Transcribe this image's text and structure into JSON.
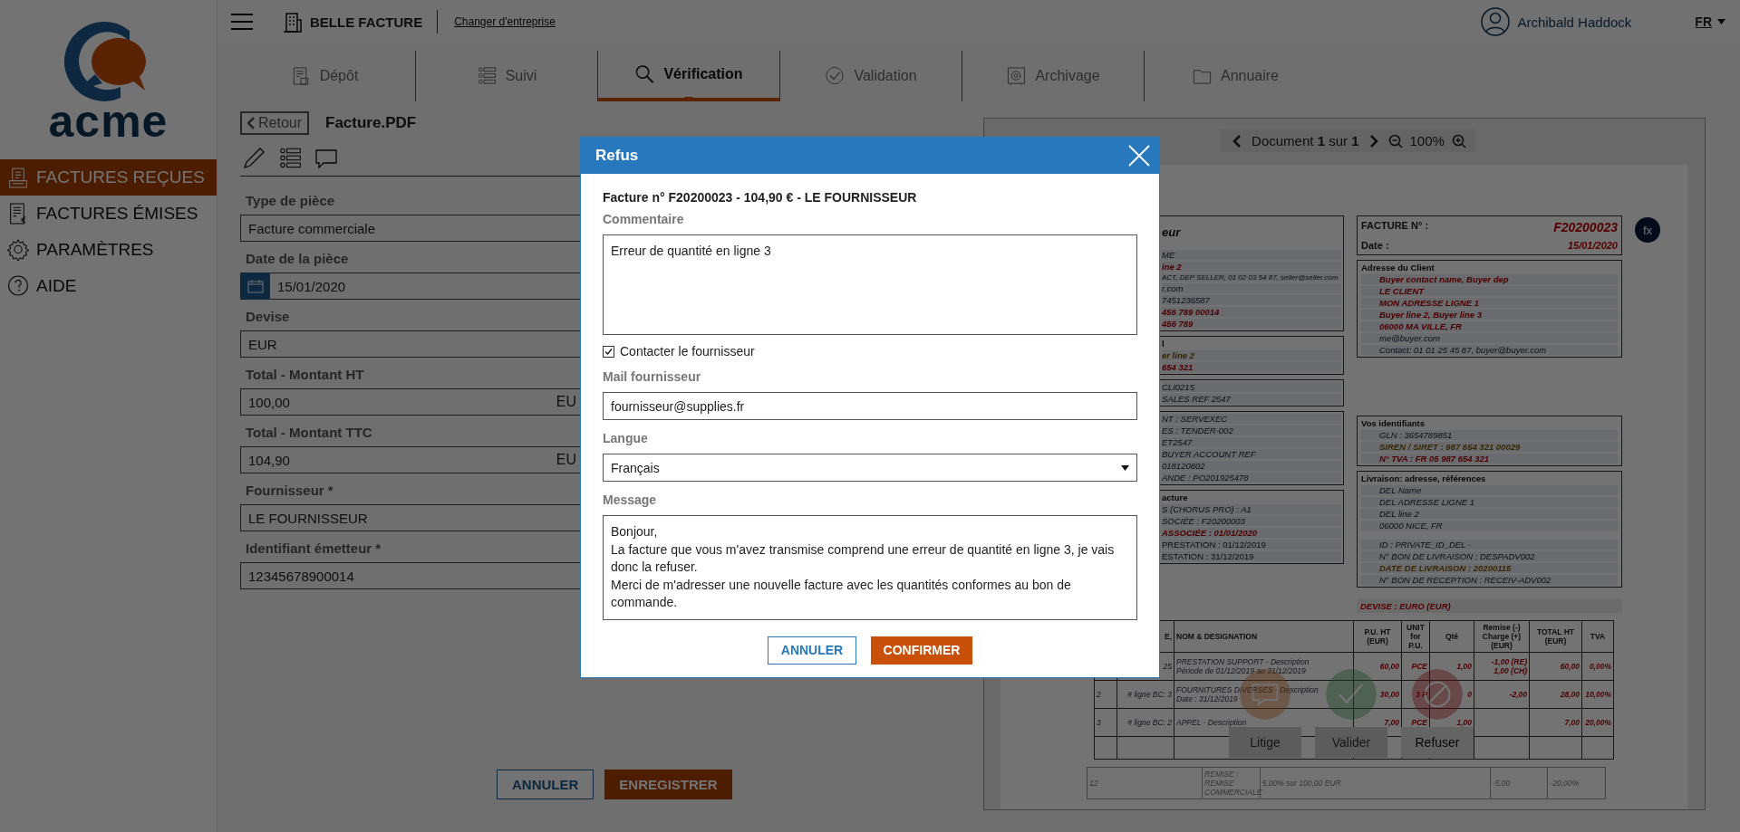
{
  "sidebar": {
    "logo_text": "acme",
    "items": [
      {
        "label": "FACTURES REÇUES",
        "selected": true
      },
      {
        "label": "FACTURES ÉMISES",
        "selected": false
      },
      {
        "label": "PARAMÈTRES",
        "selected": false
      },
      {
        "label": "AIDE",
        "selected": false
      }
    ]
  },
  "topbar": {
    "company": "BELLE FACTURE",
    "switch_link": "Changer d'entreprise",
    "user": "Archibald Haddock",
    "language": "FR"
  },
  "tabs": [
    {
      "label": "Dépôt",
      "selected": false
    },
    {
      "label": "Suivi",
      "selected": false
    },
    {
      "label": "Vérification",
      "selected": true
    },
    {
      "label": "Validation",
      "selected": false
    },
    {
      "label": "Archivage",
      "selected": false
    },
    {
      "label": "Annuaire",
      "selected": false
    }
  ],
  "form": {
    "back": "Retour",
    "filename": "Facture.PDF",
    "fields": [
      {
        "label": "Type de pièce",
        "value": "Facture commerciale",
        "kind": "text"
      },
      {
        "label": "Date de la pièce",
        "value": "15/01/2020",
        "kind": "date"
      },
      {
        "label": "Devise",
        "value": "EUR",
        "kind": "text"
      },
      {
        "label": "Total - Montant HT",
        "value": "100,00",
        "kind": "amount",
        "suffix": "EU"
      },
      {
        "label": "Total - Montant TTC",
        "value": "104,90",
        "kind": "amount",
        "suffix": "EU"
      },
      {
        "label": "Fournisseur *",
        "value": "LE FOURNISSEUR",
        "kind": "text"
      },
      {
        "label": "Identifiant émetteur *",
        "value": "12345678900014",
        "kind": "text"
      }
    ],
    "cancel": "ANNULER",
    "save": "ENREGISTRER"
  },
  "document": {
    "pager": "Document **1** sur **1**",
    "zoom": "100%",
    "logo_text": "fx",
    "left_blocks": [
      {
        "lines": [
          {
            "text": "eur",
            "kind": "title"
          },
          {
            "text": "ME",
            "kind": "plain"
          },
          {
            "text": "ine 2",
            "kind": "red"
          },
          {
            "text": "ACT, DEP SELLER, 01 02 03 54 87, seller@seller.com",
            "kind": "small"
          },
          {
            "text": "r.com",
            "kind": "plain"
          },
          {
            "text": "7451236587",
            "kind": "plain"
          },
          {
            "text": "456 789 00014",
            "kind": "red"
          },
          {
            "text": "456 789",
            "kind": "red"
          }
        ]
      },
      {
        "lines": [
          {
            "text": "l",
            "kind": "heading"
          },
          {
            "text": "er line 2",
            "kind": "gold"
          },
          {
            "text": "654 321",
            "kind": "red"
          }
        ]
      },
      {
        "lines": [
          {
            "text": "CLI0215",
            "kind": "plain"
          },
          {
            "text": "SALES REF 2547",
            "kind": "plain"
          }
        ]
      },
      {
        "lines": [
          {
            "text": "NT : SERVEXEC",
            "kind": "plain"
          },
          {
            "text": "ES : TENDER-002",
            "kind": "plain"
          },
          {
            "text": "ET2547",
            "kind": "plain"
          },
          {
            "text": "BUYER ACCOUNT REF",
            "kind": "plain"
          },
          {
            "text": "018120802",
            "kind": "plain"
          },
          {
            "text": "ANDE : PO201925478",
            "kind": "plain"
          }
        ]
      },
      {
        "lines": [
          {
            "text": "acture",
            "kind": "heading"
          },
          {
            "text": "S (CHORUS PRO) : A1",
            "kind": "plain"
          },
          {
            "text": "SOCIÉE : F20200003",
            "kind": "plain"
          },
          {
            "text": "ASSOCIÉE : 01/01/2020",
            "kind": "red"
          },
          {
            "text": "PRESTATION : 01/12/2019",
            "kind": "upright"
          },
          {
            "text": "ESTATION : 31/12/2019",
            "kind": "upright"
          }
        ]
      }
    ],
    "invoice": {
      "number_label": "FACTURE N° :",
      "number": "F20200023",
      "date_label": "Date :",
      "date": "15/01/2020"
    },
    "right_blocks": [
      {
        "lines": [
          {
            "text": "Adresse du Client",
            "kind": "heading"
          },
          {
            "text": "Buyer contact name, Buyer dep",
            "kind": "red"
          },
          {
            "text": "LE CLIENT",
            "kind": "red"
          },
          {
            "text": "MON ADRESSE LIGNE 1",
            "kind": "red"
          },
          {
            "text": "Buyer line 2, Buyer line 3",
            "kind": "red"
          },
          {
            "text": "06000 MA VILLE, FR",
            "kind": "red"
          },
          {
            "text": "me@buyer.com",
            "kind": "plain"
          },
          {
            "text": "Contact: 01 01 25 45 87, buyer@buyer.com",
            "kind": "plain"
          }
        ]
      },
      {
        "lines": [
          {
            "text": "Vos identifiants",
            "kind": "heading"
          },
          {
            "text": "GLN : 3654789851",
            "kind": "plain"
          },
          {
            "text": "SIREN / SIRET : 987 654 321 00029",
            "kind": "gold"
          },
          {
            "text": "N° TVA : FR 05 987 654 321",
            "kind": "red"
          }
        ]
      },
      {
        "lines": [
          {
            "text": "Livraison: adresse, références",
            "kind": "heading"
          },
          {
            "text": "DEL Name",
            "kind": "plain"
          },
          {
            "text": "DEL ADRESSE LIGNE 1",
            "kind": "plain"
          },
          {
            "text": "DEL line 2",
            "kind": "plain"
          },
          {
            "text": "06000 NICE, FR",
            "kind": "plain"
          },
          {
            "text": "ID : PRIVATE_ID_DEL -",
            "kind": "spaced"
          },
          {
            "text": "N° BON DE LIVRAISON : DESPADV002",
            "kind": "plain"
          },
          {
            "text": "DATE DE LIVRAISON : 20200115",
            "kind": "gold"
          },
          {
            "text": "N° BON DE RECEPTION : RECEIV-ADV002",
            "kind": "plain"
          }
        ]
      }
    ],
    "currency": "DEVISE : EURO (EUR)",
    "table": {
      "columns": [
        null,
        "E,",
        "NOM & DESIGNATION",
        "P.U. HT (EUR)",
        "UNIT for P.U.",
        "Qté",
        "Remise (-) Charge (+) (EUR)",
        "TOTAL HT (EUR)",
        "TVA"
      ],
      "rows": [
        [
          null,
          "25",
          "PRESTATION SUPPORT - Description\nPériode de 01/12/2019 au 31/12/2019",
          "60,00",
          "PCE",
          "1,00",
          "-1,00 (RE)\n1,00 (CH)",
          "60,00",
          "0,00%"
        ],
        [
          "2",
          "# ligne BC: 3",
          "FOURNITURES DIVERSES - Description\nDate : 31/12/2019",
          "30,00",
          "3 P",
          "0",
          "-2,00",
          "28,00",
          "10,00%"
        ],
        [
          "3",
          "# ligne BC: 2",
          "APPEL - Description",
          "7,00",
          "PCE",
          "1,00",
          null,
          "7,00",
          "20,00%"
        ]
      ],
      "footer": [
        "12",
        "REMISE : REMISE COMMERCIALE",
        "5,00% sur 100,00 EUR",
        "-5,00",
        "-20,00%"
      ]
    },
    "actions": [
      {
        "label": "Litige",
        "selected": false
      },
      {
        "label": "Valider",
        "selected": false
      },
      {
        "label": "Refuser",
        "selected": true
      }
    ]
  },
  "modal": {
    "title": "Refus",
    "summary": "Facture n° F20200023 - 104,90 € - LE FOURNISSEUR",
    "comment": {
      "label": "Commentaire",
      "value": "Erreur de quantité en ligne 3"
    },
    "contact": {
      "label": "Contacter le fournisseur",
      "checked": true
    },
    "mail": {
      "label": "Mail fournisseur",
      "value": "fournisseur@supplies.fr"
    },
    "language": {
      "label": "Langue",
      "value": "Français"
    },
    "message": {
      "label": "Message",
      "value": "Bonjour,\nLa facture que vous m'avez transmise comprend une erreur de quantité en ligne 3, je vais donc la refuser.\nMerci de m'adresser une nouvelle facture avec les quantités conformes au bon de commande."
    },
    "cancel": "ANNULER",
    "confirm": "CONFIRMER"
  }
}
